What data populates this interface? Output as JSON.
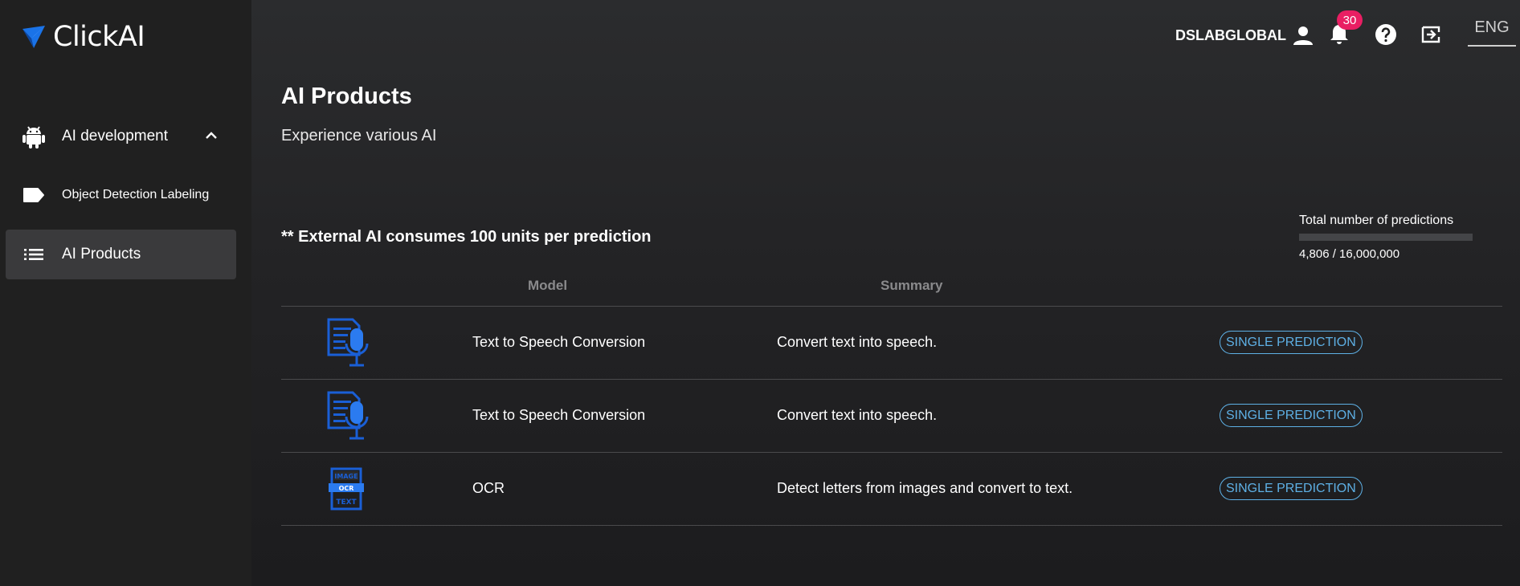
{
  "brand": {
    "name": "ClickAI",
    "accent": "#1a73e8"
  },
  "sidebar": {
    "items": [
      {
        "label": "AI development",
        "icon": "android-icon",
        "expanded": true
      },
      {
        "label": "Object Detection Labeling",
        "icon": "label-tag-icon"
      },
      {
        "label": "AI Products",
        "icon": "list-icon",
        "active": true
      }
    ]
  },
  "header": {
    "user": "DSLABGLOBAL",
    "notification_count": "30",
    "language": "ENG"
  },
  "main": {
    "title": "AI Products",
    "subtitle": "Experience various AI",
    "notice": "** External AI consumes 100 units per prediction",
    "predictions": {
      "label": "Total number of predictions",
      "count_text": "4,806 / 16,000,000",
      "used": 4806,
      "total": 16000000
    },
    "table": {
      "columns": [
        "Model",
        "Summary"
      ],
      "rows": [
        {
          "icon": "text-to-speech-icon",
          "name": "Text to Speech Conversion",
          "summary": "Convert text into speech.",
          "action": "SINGLE PREDICTION"
        },
        {
          "icon": "text-to-speech-icon",
          "name": "Text to Speech Conversion",
          "summary": "Convert text into speech.",
          "action": "SINGLE PREDICTION"
        },
        {
          "icon": "ocr-icon",
          "name": "OCR",
          "summary": "Detect letters from images and convert to text.",
          "action": "SINGLE PREDICTION",
          "icon_text": [
            "IMAGE",
            "OCR",
            "TEXT"
          ]
        }
      ]
    }
  }
}
